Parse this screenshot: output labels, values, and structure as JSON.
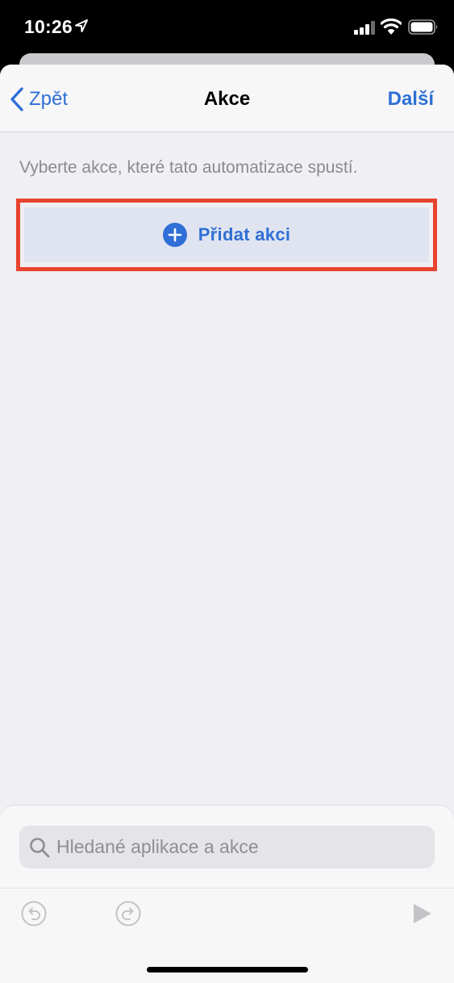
{
  "status_bar": {
    "time": "10:26"
  },
  "nav": {
    "back_label": "Zpět",
    "title": "Akce",
    "next_label": "Další"
  },
  "content": {
    "hint": "Vyberte akce, které tato automatizace spustí.",
    "add_action_label": "Přidat akci"
  },
  "bottom": {
    "search_placeholder": "Hledané aplikace a akce"
  },
  "colors": {
    "accent": "#2f6fd6",
    "highlight": "#e8432d",
    "background": "#efeff4"
  },
  "icons": [
    "location-icon",
    "signal-icon",
    "wifi-icon",
    "battery-icon",
    "chevron-left-icon",
    "plus-circle-icon",
    "search-icon",
    "undo-icon",
    "redo-icon",
    "play-icon"
  ]
}
